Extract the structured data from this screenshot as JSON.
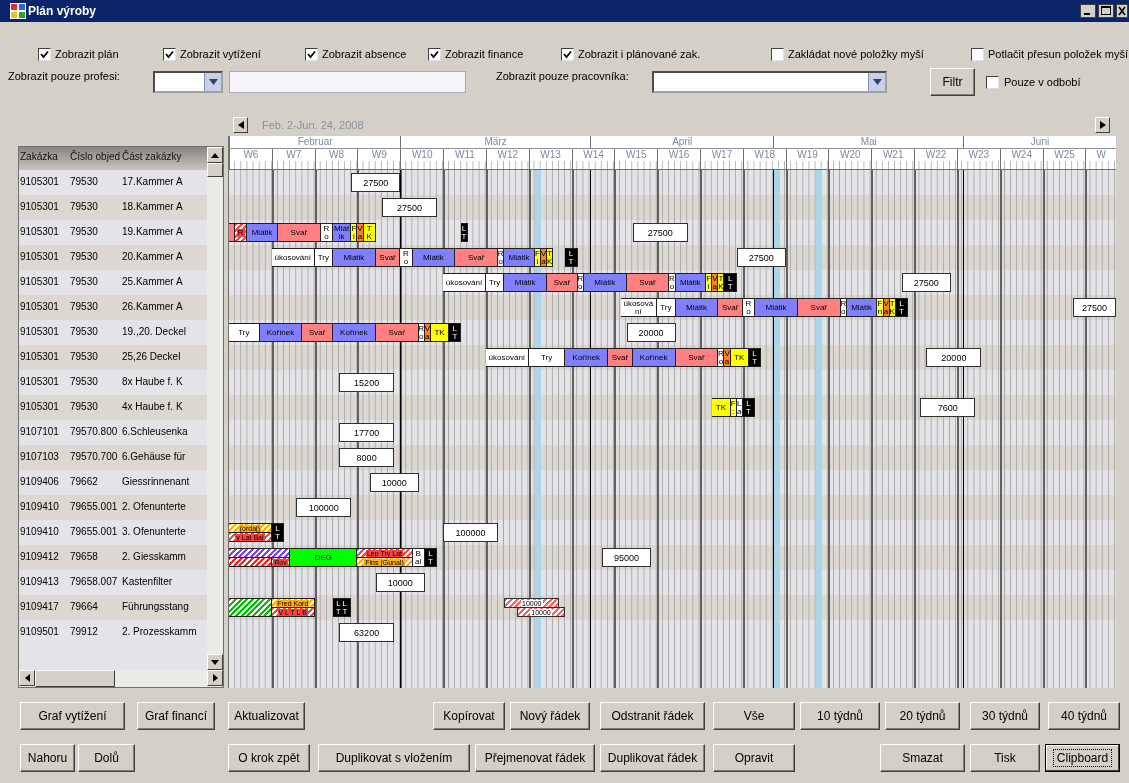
{
  "window": {
    "title": "Plán výroby"
  },
  "options": [
    {
      "label": "Zobrazit plán",
      "checked": true
    },
    {
      "label": "Zobrazit vytížení",
      "checked": true
    },
    {
      "label": "Zobrazit absence",
      "checked": true
    },
    {
      "label": "Zobrazit finance",
      "checked": true
    },
    {
      "label": "Zobrazit i plánované zak.",
      "checked": true
    },
    {
      "label": "Zakládat nové položky myší",
      "checked": false
    },
    {
      "label": "Potlačit přesun položek myší",
      "checked": false
    }
  ],
  "filters": {
    "profession": {
      "label": "Zobrazit pouze profesi:"
    },
    "worker": {
      "label": "Zobrazit pouze pracovníka:"
    },
    "button": "Filtr",
    "period": {
      "label": "Pouze v odbobí",
      "checked": false
    }
  },
  "table": {
    "columns": [
      "Zakázka",
      "Číslo objed",
      "Část zakázky"
    ],
    "rows": [
      {
        "cells": [
          "9105301",
          "79530",
          "17.Kammer A"
        ]
      },
      {
        "cells": [
          "9105301",
          "79530",
          "18.Kammer A"
        ]
      },
      {
        "cells": [
          "9105301",
          "79530",
          "19.Kammer A"
        ]
      },
      {
        "cells": [
          "9105301",
          "79530",
          "20.Kammer A"
        ]
      },
      {
        "cells": [
          "9105301",
          "79530",
          "25.Kammer A"
        ]
      },
      {
        "cells": [
          "9105301",
          "79530",
          "26.Kammer A"
        ]
      },
      {
        "cells": [
          "9105301",
          "79530",
          "19.,20. Deckel"
        ]
      },
      {
        "cells": [
          "9105301",
          "79530",
          "25,26 Deckel"
        ]
      },
      {
        "cells": [
          "9105301",
          "79530",
          "8x Haube f. K"
        ]
      },
      {
        "cells": [
          "9105301",
          "79530",
          "4x Haube f. K"
        ]
      },
      {
        "cells": [
          "9107101",
          "79570.800",
          "6.Schleusenka"
        ]
      },
      {
        "cells": [
          "9107103",
          "79570.700",
          "6.Gehäuse für"
        ]
      },
      {
        "cells": [
          "9109406",
          "79662",
          "Giessrinnenant"
        ]
      },
      {
        "cells": [
          "9109410",
          "79655.001",
          "2. Ofenunterte"
        ]
      },
      {
        "cells": [
          "9109410",
          "79655.001",
          "3. Ofenunterte"
        ]
      },
      {
        "cells": [
          "9109412",
          "79658",
          "2. Giesskamm"
        ]
      },
      {
        "cells": [
          "9109413",
          "79658.007",
          "Kastenfilter"
        ]
      },
      {
        "cells": [
          "9109417",
          "79664",
          "Führungsstang"
        ]
      },
      {
        "cells": [
          "9109501",
          "79912",
          "2. Prozesskamm"
        ]
      }
    ]
  },
  "gantt": {
    "range": "Feb. 2-Jun. 24, 2008",
    "months": [
      "Februar",
      "März",
      "April",
      "Mai",
      "Juni"
    ],
    "weeks": [
      "W6",
      "W7",
      "W8",
      "W9",
      "W10",
      "W11",
      "W12",
      "W13",
      "W14",
      "W15",
      "W16",
      "W17",
      "W18",
      "W19",
      "W20",
      "W21",
      "W22",
      "W23",
      "W24",
      "W25",
      "W"
    ],
    "rows": [
      {
        "items": [
          {
            "kind": "amount",
            "label": "27500"
          }
        ]
      },
      {
        "items": [
          {
            "kind": "amount",
            "label": "27500"
          }
        ]
      },
      {
        "items": [
          {
            "kind": "bar",
            "segments": [
              {
                "color": "#ff8080"
              },
              {
                "label": "R",
                "color": "#ff4040",
                "hatched": true
              },
              {
                "label": "Mlátik",
                "color": "#8080ff"
              },
              {
                "label": "Svař",
                "color": "#ff8080"
              },
              {
                "label": "R o",
                "color": "#ffffff"
              },
              {
                "label": "Mlátik",
                "color": "#8080ff"
              },
              {
                "label": "F i",
                "color": "#ffff40"
              },
              {
                "label": "V a",
                "color": "#ff8020"
              },
              {
                "label": "T K",
                "color": "#ffff00"
              }
            ]
          },
          {
            "kind": "bar",
            "segments": [
              {
                "label": "L T",
                "color": "#000000"
              }
            ]
          },
          {
            "kind": "amount",
            "label": "27500"
          }
        ]
      },
      {
        "items": [
          {
            "kind": "bar",
            "segments": [
              {
                "label": "úkosování",
                "color": "#ffffff"
              },
              {
                "label": "Try",
                "color": "#ffffff"
              },
              {
                "label": "Mlátik",
                "color": "#8080ff"
              },
              {
                "label": "Svař",
                "color": "#ff8080"
              },
              {
                "label": "R o",
                "color": "#ffffff"
              },
              {
                "label": "Mlátik",
                "color": "#8080ff"
              },
              {
                "label": "Svař",
                "color": "#ff8080"
              },
              {
                "label": "R o",
                "color": "#ffffff"
              },
              {
                "label": "Mlátik",
                "color": "#8080ff"
              },
              {
                "label": "F i",
                "color": "#ffff40"
              },
              {
                "label": "V a",
                "color": "#ff8020"
              },
              {
                "label": "T K",
                "color": "#ffff00"
              }
            ]
          },
          {
            "kind": "bar",
            "segments": [
              {
                "label": "L T",
                "color": "#000000"
              }
            ]
          },
          {
            "kind": "amount",
            "label": "27500"
          }
        ]
      },
      {
        "items": [
          {
            "kind": "bar",
            "segments": [
              {
                "label": "úkosování",
                "color": "#ffffff"
              },
              {
                "label": "Try",
                "color": "#ffffff"
              },
              {
                "label": "Mlátik",
                "color": "#8080ff"
              },
              {
                "label": "Svař",
                "color": "#ff8080"
              },
              {
                "label": "R o",
                "color": "#ffffff"
              },
              {
                "label": "Mlátik",
                "color": "#8080ff"
              },
              {
                "label": "Svař",
                "color": "#ff8080"
              },
              {
                "label": "R o",
                "color": "#ffffff"
              },
              {
                "label": "Mlátik",
                "color": "#8080ff"
              },
              {
                "label": "F i",
                "color": "#ffff40"
              },
              {
                "label": "V a",
                "color": "#ff8020"
              },
              {
                "label": "T K",
                "color": "#ffff00"
              },
              {
                "label": "L T",
                "color": "#000000"
              }
            ]
          },
          {
            "kind": "amount",
            "label": "27500"
          }
        ]
      },
      {
        "items": [
          {
            "kind": "bar",
            "segments": [
              {
                "label": "úkosování",
                "color": "#ffffff"
              },
              {
                "label": "Try",
                "color": "#ffffff"
              },
              {
                "label": "Mlátik",
                "color": "#8080ff"
              },
              {
                "label": "Svař",
                "color": "#ff8080"
              },
              {
                "label": "R o",
                "color": "#ffffff"
              },
              {
                "label": "Mlátik",
                "color": "#8080ff"
              },
              {
                "label": "Svař",
                "color": "#ff8080"
              },
              {
                "label": "R o",
                "color": "#ffffff"
              },
              {
                "label": "Mlátik",
                "color": "#8080ff"
              },
              {
                "label": "F n",
                "color": "#ffff40"
              },
              {
                "label": "V a",
                "color": "#ff8020"
              },
              {
                "label": "T K",
                "color": "#ffff00"
              },
              {
                "label": "L T",
                "color": "#000000"
              }
            ]
          },
          {
            "kind": "amount",
            "label": "27500"
          }
        ]
      },
      {
        "items": [
          {
            "kind": "bar",
            "segments": [
              {
                "label": "Try",
                "color": "#ffffff"
              },
              {
                "label": "Kořínek",
                "color": "#8080ff"
              },
              {
                "label": "Svař",
                "color": "#ff8080"
              },
              {
                "label": "Kořínek",
                "color": "#8080ff"
              },
              {
                "label": "Svař",
                "color": "#ff8080"
              },
              {
                "label": "R o",
                "color": "#ffffff"
              },
              {
                "label": "V a",
                "color": "#ff8020"
              },
              {
                "label": "TK",
                "color": "#ffff00"
              },
              {
                "label": "L T",
                "color": "#000000"
              }
            ]
          },
          {
            "kind": "amount",
            "label": "20000"
          }
        ]
      },
      {
        "items": [
          {
            "kind": "bar",
            "segments": [
              {
                "label": "úkosování",
                "color": "#ffffff"
              },
              {
                "label": "Try",
                "color": "#ffffff"
              },
              {
                "label": "Kořínek",
                "color": "#8080ff"
              },
              {
                "label": "Svař",
                "color": "#ff8080"
              },
              {
                "label": "Kořínek",
                "color": "#8080ff"
              },
              {
                "label": "Svař",
                "color": "#ff8080"
              },
              {
                "label": "R o",
                "color": "#ffffff"
              },
              {
                "label": "V a",
                "color": "#ff8020"
              },
              {
                "label": "TK",
                "color": "#ffff00"
              },
              {
                "label": "L T",
                "color": "#000000"
              }
            ]
          },
          {
            "kind": "amount",
            "label": "20000"
          }
        ]
      },
      {
        "items": [
          {
            "kind": "amount",
            "label": "15200"
          }
        ]
      },
      {
        "items": [
          {
            "kind": "bar",
            "segments": [
              {
                "label": "TK",
                "color": "#ffff00"
              },
              {
                "label": "F :",
                "color": "#ffff40"
              },
              {
                "label": "L a",
                "color": "#ffffff"
              },
              {
                "label": "L T",
                "color": "#000000"
              }
            ]
          },
          {
            "kind": "amount",
            "label": "7600"
          }
        ]
      },
      {
        "items": [
          {
            "kind": "amount",
            "label": "17700"
          }
        ]
      },
      {
        "items": [
          {
            "kind": "amount",
            "label": "8000"
          }
        ]
      },
      {
        "items": [
          {
            "kind": "amount",
            "label": "10000"
          }
        ]
      },
      {
        "items": [
          {
            "kind": "amount",
            "label": "100000"
          }
        ]
      },
      {
        "items": [
          {
            "kind": "bar",
            "segments": [
              {
                "label": "(ordaj)",
                "color": "#ffb000",
                "hatched": true
              }
            ]
          },
          {
            "kind": "bar",
            "segments": [
              {
                "label": "y Lat Bal",
                "color": "#ff4040",
                "hatched": true
              }
            ]
          },
          {
            "kind": "bar",
            "segments": [
              {
                "label": "L T",
                "color": "#000000"
              }
            ]
          },
          {
            "kind": "amount",
            "label": "100000"
          }
        ]
      },
      {
        "items": [
          {
            "kind": "bar",
            "segments": [
              {
                "color": "#8040ff",
                "hatched": true
              }
            ]
          },
          {
            "kind": "bar",
            "segments": [
              {
                "color": "#ff2020",
                "hatched": true
              },
              {
                "label": "Rov",
                "color": "#ff4040",
                "hatched": true
              }
            ]
          },
          {
            "kind": "bar",
            "segments": [
              {
                "label": "DEG",
                "color": "#00ff00"
              }
            ]
          },
          {
            "kind": "bar",
            "segments": [
              {
                "label": "Lep Try Lat",
                "color": "#ff4040",
                "hatched": true
              }
            ]
          },
          {
            "kind": "bar",
            "segments": [
              {
                "label": "Fins (Gunal)",
                "color": "#ffb000",
                "hatched": true
              }
            ]
          },
          {
            "kind": "bar",
            "segments": [
              {
                "label": "Bal",
                "color": "#ffffff"
              },
              {
                "label": "L T",
                "color": "#000000"
              }
            ]
          },
          {
            "kind": "amount",
            "label": "95000"
          }
        ]
      },
      {
        "items": [
          {
            "kind": "amount",
            "label": "10000"
          }
        ]
      },
      {
        "items": [
          {
            "kind": "bar",
            "segments": [
              {
                "color": "#00c000",
                "hatched": true
              }
            ]
          },
          {
            "kind": "bar",
            "segments": [
              {
                "label": "Fred Kord",
                "color": "#ffb000",
                "hatched": true
              }
            ]
          },
          {
            "kind": "bar",
            "segments": [
              {
                "label": "V L T L B",
                "color": "#ff4040",
                "hatched": true
              }
            ]
          },
          {
            "kind": "bar",
            "segments": [
              {
                "label": "L L T T",
                "color": "#000000"
              }
            ]
          },
          {
            "kind": "amount",
            "label": "10000",
            "hatched": true
          },
          {
            "kind": "amount",
            "label": "10000",
            "hatched": true
          }
        ]
      },
      {
        "items": [
          {
            "kind": "amount",
            "label": "63200"
          }
        ]
      }
    ]
  },
  "button_rows": [
    {
      "buttons": [
        {
          "label": "Graf vytížení",
          "focused": false
        },
        {
          "label": "Graf financí",
          "focused": false
        },
        {
          "label": "Aktualizovat",
          "focused": false
        },
        {
          "label": "Kopírovat",
          "focused": false
        },
        {
          "label": "Nový řádek",
          "focused": false
        },
        {
          "label": "Odstranit řádek",
          "focused": false
        },
        {
          "label": "Vše",
          "focused": false
        },
        {
          "label": "10 týdnů",
          "focused": false
        },
        {
          "label": "20 týdnů",
          "focused": false
        },
        {
          "label": "30 týdnů",
          "focused": false
        },
        {
          "label": "40 týdnů",
          "focused": false
        }
      ]
    },
    {
      "buttons": [
        {
          "label": "Nahoru",
          "focused": false
        },
        {
          "label": "Dolů",
          "focused": false
        },
        {
          "label": "O krok zpět",
          "focused": false
        },
        {
          "label": "Duplikovat s vložením",
          "focused": false
        },
        {
          "label": "Přejmenovat řádek",
          "focused": false
        },
        {
          "label": "Duplikovat řádek",
          "focused": false
        },
        {
          "label": "Opravit",
          "focused": false
        },
        {
          "label": "Smazat",
          "focused": false
        },
        {
          "label": "Tisk",
          "focused": false
        },
        {
          "label": "Clipboard",
          "focused": true
        }
      ]
    }
  ]
}
